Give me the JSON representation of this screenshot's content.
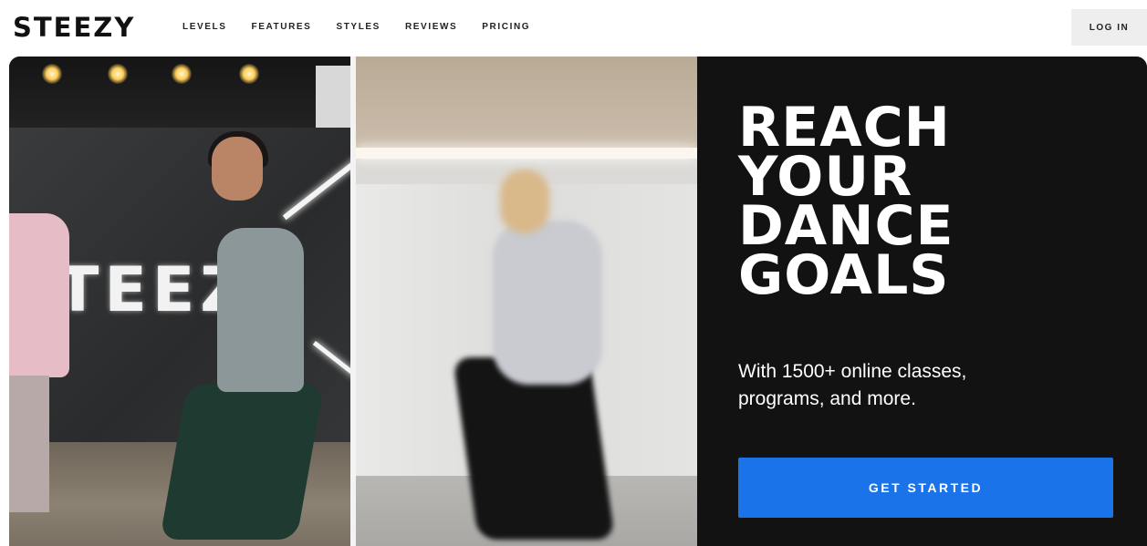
{
  "header": {
    "logo": "STEEZY",
    "nav": [
      "LEVELS",
      "FEATURES",
      "STYLES",
      "REVIEWS",
      "PRICING"
    ],
    "login_label": "LOG IN"
  },
  "hero": {
    "wall_logo": "TEEZY",
    "headline": [
      "REACH",
      "YOUR",
      "DANCE",
      "GOALS"
    ],
    "subtext_line1": "With 1500+ online classes,",
    "subtext_line2": "programs, and more.",
    "cta_label": "GET STARTED"
  },
  "colors": {
    "accent": "#1a73e8",
    "hero_background": "#121212"
  }
}
